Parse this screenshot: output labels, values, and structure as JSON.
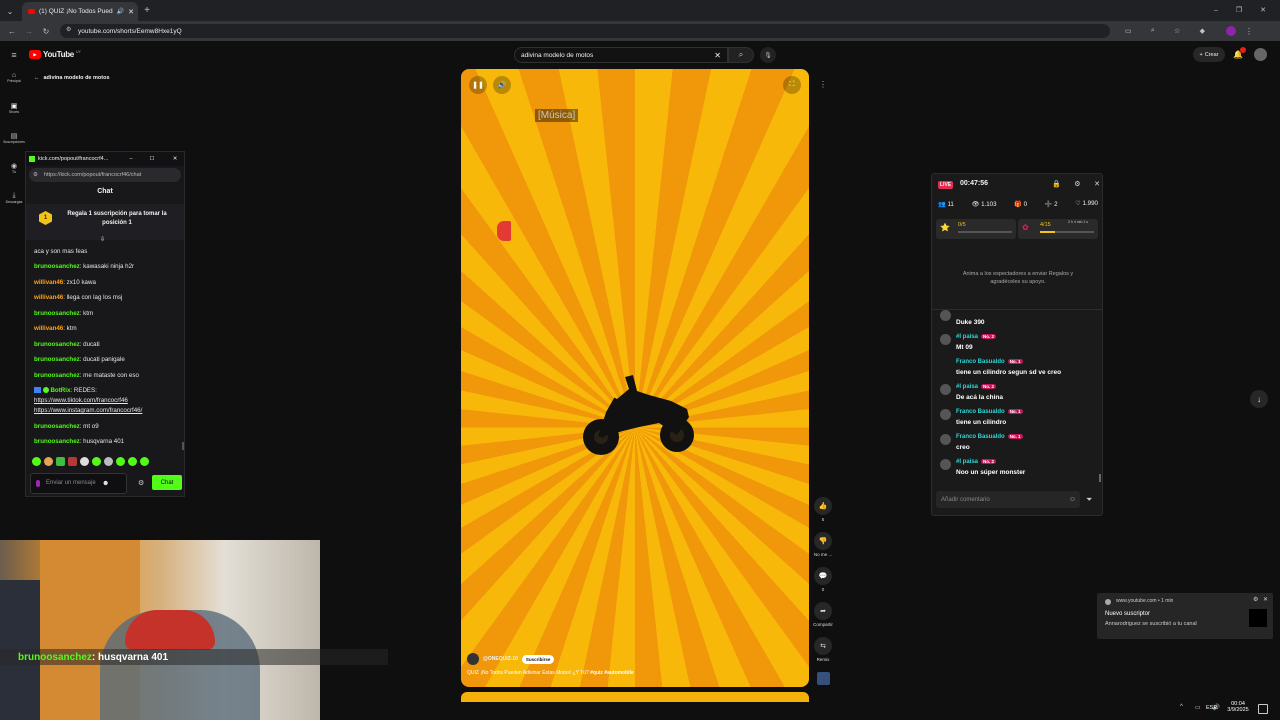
{
  "browser": {
    "tab_title": "(1) QUIZ ¡No Todos Pueden",
    "url": "youtube.com/shorts/Eemw8Hxe1yQ"
  },
  "youtube": {
    "logo": "YouTube",
    "logo_country": "UY",
    "search_value": "adivina modelo de motos",
    "back_label": "adivina modelo de motos",
    "create_label": "Crear",
    "sidebar": [
      {
        "icon": "home-icon",
        "label": "Principal"
      },
      {
        "icon": "shorts-icon",
        "label": "Shorts"
      },
      {
        "icon": "subscriptions-icon",
        "label": "Suscripciones"
      },
      {
        "icon": "you-icon",
        "label": "Tú"
      },
      {
        "icon": "download-icon",
        "label": "Descargas"
      }
    ]
  },
  "video": {
    "caption": "[Música]",
    "channel": "@ONEQUIZ-10",
    "subscribe_label": "Suscribirse",
    "title": "QUIZ ¡No Todos Pueden Adivinar Estas Motos! ¿Y Tú? ",
    "hashtags": "#quiz #automobile",
    "actions": [
      {
        "name": "like-button",
        "icon": "👍",
        "label": "5"
      },
      {
        "name": "dislike-button",
        "icon": "👎",
        "label": "No me ..."
      },
      {
        "name": "comments-button",
        "icon": "💬",
        "label": "0"
      },
      {
        "name": "share-button",
        "icon": "➦",
        "label": "Compartir"
      },
      {
        "name": "remix-button",
        "icon": "⇆",
        "label": "Remix"
      }
    ]
  },
  "kick": {
    "window_title": "kick.com/popout/francocrf4...",
    "url": "https://kick.com/popout/francocrf46/chat",
    "header": "Chat",
    "gift_text": "Regala 1 suscripción para tomar la posición 1",
    "gift_rank": "1",
    "messages": [
      {
        "user": "",
        "cls": "",
        "text": "aca y son mas feas"
      },
      {
        "user": "brunoosanchez",
        "cls": "u-green",
        "text": ": kawasaki ninja h2r"
      },
      {
        "user": "willivan46",
        "cls": "u-orange",
        "text": ": zx10 kawa"
      },
      {
        "user": "willivan46",
        "cls": "u-orange",
        "text": ": llega con lag los msj"
      },
      {
        "user": "brunoosanchez",
        "cls": "u-green",
        "text": ": ktm"
      },
      {
        "user": "willivan46",
        "cls": "u-orange",
        "text": ": ktm"
      },
      {
        "user": "brunoosanchez",
        "cls": "u-green",
        "text": ": ducati"
      },
      {
        "user": "brunoosanchez",
        "cls": "u-green",
        "text": ": ducati panigale"
      },
      {
        "user": "brunoosanchez",
        "cls": "u-green",
        "text": ": me mataste con eso"
      }
    ],
    "botrix_user": "BotRix",
    "botrix_text": ": REDES:",
    "links": [
      "https://www.tiktok.com/francocrf46",
      "https://www.instagram.com/francocrf46/"
    ],
    "messages2": [
      {
        "user": "brunoosanchez",
        "cls": "u-green",
        "text": ": mt o9"
      },
      {
        "user": "brunoosanchez",
        "cls": "u-green",
        "text": ": husqvarna 401"
      }
    ],
    "input_placeholder": "Enviar un mensaje",
    "send_label": "Chat"
  },
  "live": {
    "badge": "LIVE",
    "timer": "00:47:56",
    "stats": [
      "11",
      "1.103",
      "0",
      "2",
      "1.990"
    ],
    "goal1": "0/5",
    "goal2": "4/15",
    "goal2_extra": "2 h 4 min 1 s",
    "goal2_progress": 0.27,
    "empty_text": "Anima a los espectadores a enviar Regalos y agradéceles su apoyo.",
    "comments": [
      {
        "name": "",
        "badge": "",
        "msg": "Duke 390",
        "cls": "u-cyan"
      },
      {
        "name": "#I paisa",
        "badge": "No. 2",
        "msg": "Mt 09",
        "cls": "u-cyan"
      },
      {
        "name": "Franco Basualdo",
        "badge": "No. 1",
        "msg": "tiene un cilindro segun sd ve creo",
        "cls": "u-cyan"
      },
      {
        "name": "#I paisa",
        "badge": "No. 2",
        "msg": "De acá la china",
        "cls": "u-cyan"
      },
      {
        "name": "Franco Basualdo",
        "badge": "No. 1",
        "msg": "tiene un cilindro",
        "cls": "u-cyan"
      },
      {
        "name": "Franco Basualdo",
        "badge": "No. 1",
        "msg": "creo",
        "cls": "u-cyan"
      },
      {
        "name": "#I paisa",
        "badge": "No. 2",
        "msg": "Noo un súper monster",
        "cls": "u-cyan"
      }
    ],
    "comment_placeholder": "Añadir comentario"
  },
  "toast": {
    "source": "www.youtube.com • 1 min",
    "title": "Nuevo suscriptor",
    "body": "Annarodriguez se suscribió a tu canal"
  },
  "webcam": {
    "overlay_user": "brunoosanchez",
    "overlay_text": " : husqvarna 401"
  },
  "taskbar": {
    "lang": "ESP",
    "time": "00:04",
    "date": "3/9/2025"
  }
}
